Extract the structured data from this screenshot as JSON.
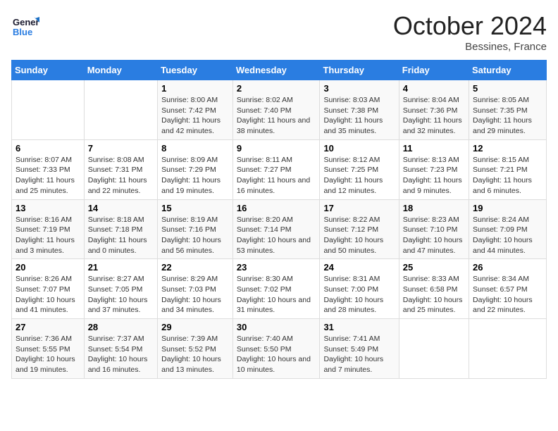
{
  "header": {
    "logo_line1": "General",
    "logo_line2": "Blue",
    "month": "October 2024",
    "location": "Bessines, France"
  },
  "weekdays": [
    "Sunday",
    "Monday",
    "Tuesday",
    "Wednesday",
    "Thursday",
    "Friday",
    "Saturday"
  ],
  "weeks": [
    [
      {
        "day": "",
        "info": ""
      },
      {
        "day": "",
        "info": ""
      },
      {
        "day": "1",
        "info": "Sunrise: 8:00 AM\nSunset: 7:42 PM\nDaylight: 11 hours and 42 minutes."
      },
      {
        "day": "2",
        "info": "Sunrise: 8:02 AM\nSunset: 7:40 PM\nDaylight: 11 hours and 38 minutes."
      },
      {
        "day": "3",
        "info": "Sunrise: 8:03 AM\nSunset: 7:38 PM\nDaylight: 11 hours and 35 minutes."
      },
      {
        "day": "4",
        "info": "Sunrise: 8:04 AM\nSunset: 7:36 PM\nDaylight: 11 hours and 32 minutes."
      },
      {
        "day": "5",
        "info": "Sunrise: 8:05 AM\nSunset: 7:35 PM\nDaylight: 11 hours and 29 minutes."
      }
    ],
    [
      {
        "day": "6",
        "info": "Sunrise: 8:07 AM\nSunset: 7:33 PM\nDaylight: 11 hours and 25 minutes."
      },
      {
        "day": "7",
        "info": "Sunrise: 8:08 AM\nSunset: 7:31 PM\nDaylight: 11 hours and 22 minutes."
      },
      {
        "day": "8",
        "info": "Sunrise: 8:09 AM\nSunset: 7:29 PM\nDaylight: 11 hours and 19 minutes."
      },
      {
        "day": "9",
        "info": "Sunrise: 8:11 AM\nSunset: 7:27 PM\nDaylight: 11 hours and 16 minutes."
      },
      {
        "day": "10",
        "info": "Sunrise: 8:12 AM\nSunset: 7:25 PM\nDaylight: 11 hours and 12 minutes."
      },
      {
        "day": "11",
        "info": "Sunrise: 8:13 AM\nSunset: 7:23 PM\nDaylight: 11 hours and 9 minutes."
      },
      {
        "day": "12",
        "info": "Sunrise: 8:15 AM\nSunset: 7:21 PM\nDaylight: 11 hours and 6 minutes."
      }
    ],
    [
      {
        "day": "13",
        "info": "Sunrise: 8:16 AM\nSunset: 7:19 PM\nDaylight: 11 hours and 3 minutes."
      },
      {
        "day": "14",
        "info": "Sunrise: 8:18 AM\nSunset: 7:18 PM\nDaylight: 11 hours and 0 minutes."
      },
      {
        "day": "15",
        "info": "Sunrise: 8:19 AM\nSunset: 7:16 PM\nDaylight: 10 hours and 56 minutes."
      },
      {
        "day": "16",
        "info": "Sunrise: 8:20 AM\nSunset: 7:14 PM\nDaylight: 10 hours and 53 minutes."
      },
      {
        "day": "17",
        "info": "Sunrise: 8:22 AM\nSunset: 7:12 PM\nDaylight: 10 hours and 50 minutes."
      },
      {
        "day": "18",
        "info": "Sunrise: 8:23 AM\nSunset: 7:10 PM\nDaylight: 10 hours and 47 minutes."
      },
      {
        "day": "19",
        "info": "Sunrise: 8:24 AM\nSunset: 7:09 PM\nDaylight: 10 hours and 44 minutes."
      }
    ],
    [
      {
        "day": "20",
        "info": "Sunrise: 8:26 AM\nSunset: 7:07 PM\nDaylight: 10 hours and 41 minutes."
      },
      {
        "day": "21",
        "info": "Sunrise: 8:27 AM\nSunset: 7:05 PM\nDaylight: 10 hours and 37 minutes."
      },
      {
        "day": "22",
        "info": "Sunrise: 8:29 AM\nSunset: 7:03 PM\nDaylight: 10 hours and 34 minutes."
      },
      {
        "day": "23",
        "info": "Sunrise: 8:30 AM\nSunset: 7:02 PM\nDaylight: 10 hours and 31 minutes."
      },
      {
        "day": "24",
        "info": "Sunrise: 8:31 AM\nSunset: 7:00 PM\nDaylight: 10 hours and 28 minutes."
      },
      {
        "day": "25",
        "info": "Sunrise: 8:33 AM\nSunset: 6:58 PM\nDaylight: 10 hours and 25 minutes."
      },
      {
        "day": "26",
        "info": "Sunrise: 8:34 AM\nSunset: 6:57 PM\nDaylight: 10 hours and 22 minutes."
      }
    ],
    [
      {
        "day": "27",
        "info": "Sunrise: 7:36 AM\nSunset: 5:55 PM\nDaylight: 10 hours and 19 minutes."
      },
      {
        "day": "28",
        "info": "Sunrise: 7:37 AM\nSunset: 5:54 PM\nDaylight: 10 hours and 16 minutes."
      },
      {
        "day": "29",
        "info": "Sunrise: 7:39 AM\nSunset: 5:52 PM\nDaylight: 10 hours and 13 minutes."
      },
      {
        "day": "30",
        "info": "Sunrise: 7:40 AM\nSunset: 5:50 PM\nDaylight: 10 hours and 10 minutes."
      },
      {
        "day": "31",
        "info": "Sunrise: 7:41 AM\nSunset: 5:49 PM\nDaylight: 10 hours and 7 minutes."
      },
      {
        "day": "",
        "info": ""
      },
      {
        "day": "",
        "info": ""
      }
    ]
  ]
}
